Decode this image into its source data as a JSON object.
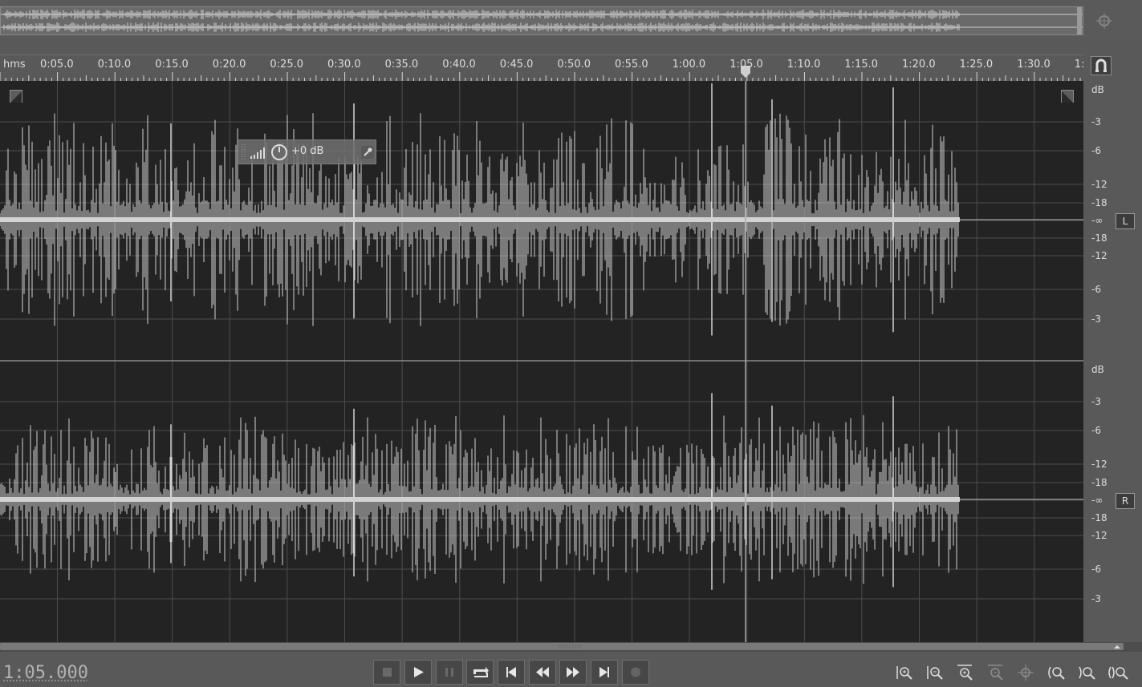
{
  "ruler": {
    "unit": "hms",
    "ticks": [
      "0:05.0",
      "0:10.0",
      "0:15.0",
      "0:20.0",
      "0:25.0",
      "0:30.0",
      "0:35.0",
      "0:40.0",
      "0:45.0",
      "0:50.0",
      "0:55.0",
      "1:00.0",
      "1:05.0",
      "1:10.0",
      "1:15.0",
      "1:20.0",
      "1:25.0",
      "1:30.0",
      "1:"
    ]
  },
  "hud": {
    "gain": "+0 dB"
  },
  "db_scale": {
    "unit": "dB",
    "top_labels": [
      "-3",
      "-6",
      "-12",
      "-18",
      "-∞",
      "-18",
      "-12",
      "-6",
      "-3"
    ],
    "left_channel": "L",
    "right_channel": "R"
  },
  "status": {
    "time": "1:05.000"
  },
  "transport": {
    "buttons": [
      "stop",
      "play",
      "pause",
      "loop",
      "skip-to-start",
      "rewind",
      "fast-forward",
      "skip-to-end",
      "record"
    ]
  },
  "zoom": {
    "buttons": [
      "zoom-in-amplitude",
      "zoom-out-amplitude",
      "zoom-in-full",
      "zoom-out-full",
      "zoom-selection",
      "zoom-in-left",
      "zoom-in-right",
      "zoom-out-all"
    ]
  },
  "colors": {
    "waveform": "#d2d2d2",
    "background": "#232323",
    "grid": "#4c4c4c",
    "playhead": "#a8a8a8"
  }
}
